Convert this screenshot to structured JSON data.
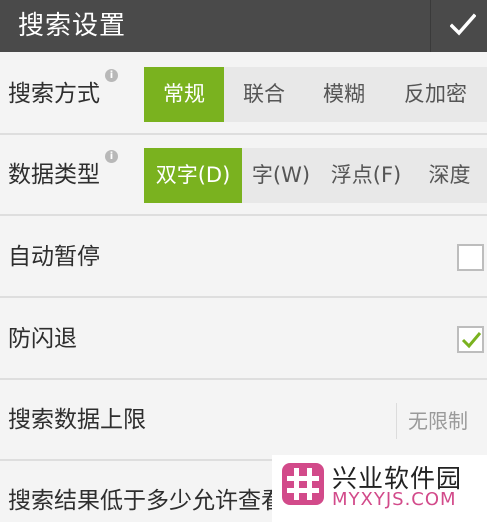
{
  "header": {
    "title": "搜索设置",
    "confirm_icon": "checkmark-icon"
  },
  "rows": [
    {
      "label": "搜索方式",
      "options": [
        "常规",
        "联合",
        "模糊",
        "反加密"
      ],
      "selected": "常规"
    },
    {
      "label": "数据类型",
      "options": [
        "双字(D)",
        "字(W)",
        "浮点(F)",
        "深度"
      ],
      "selected": "双字(D)"
    },
    {
      "label": "自动暂停",
      "checked": false
    },
    {
      "label": "防闪退",
      "checked": true
    },
    {
      "label": "搜索数据上限",
      "value": "无限制"
    },
    {
      "label": "搜索结果低于多少允许查看"
    }
  ],
  "watermark": {
    "name": "兴业软件园",
    "url": "MYXYJS.COM"
  },
  "colors": {
    "header_bg": "#4a4a4a",
    "accent": "#7ab21f",
    "segment_bg": "#e8e8e8",
    "page_bg": "#f4f4f4"
  }
}
